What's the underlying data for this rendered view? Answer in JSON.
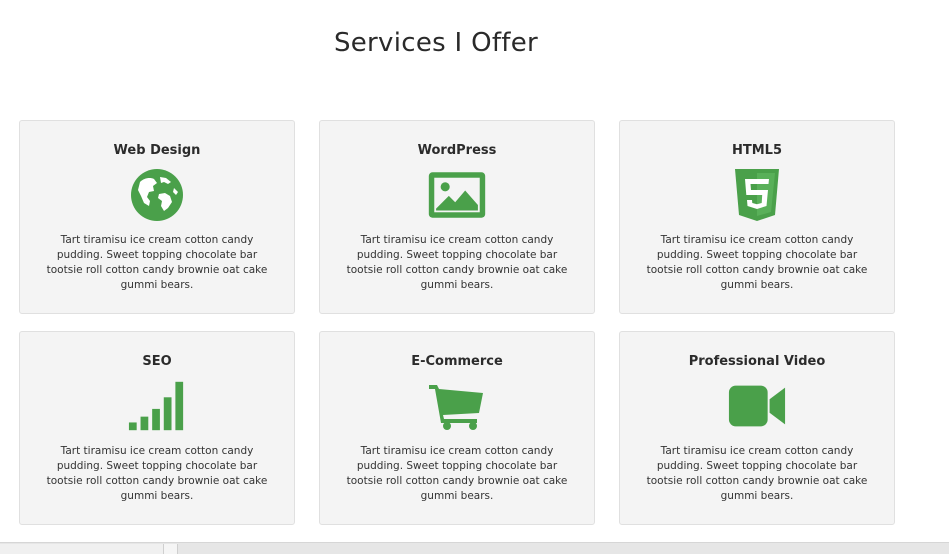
{
  "page": {
    "title": "Services I Offer"
  },
  "theme": {
    "accent": "#4aa04a",
    "card_bg": "#f4f4f4"
  },
  "services": [
    {
      "title": "Web Design",
      "icon": "globe-icon",
      "text": "Tart tiramisu ice cream cotton candy pudding. Sweet topping chocolate bar tootsie roll cotton candy brownie oat cake gummi bears."
    },
    {
      "title": "WordPress",
      "icon": "image-icon",
      "text": "Tart tiramisu ice cream cotton candy pudding. Sweet topping chocolate bar tootsie roll cotton candy brownie oat cake gummi bears."
    },
    {
      "title": "HTML5",
      "icon": "html5-icon",
      "text": "Tart tiramisu ice cream cotton candy pudding. Sweet topping chocolate bar tootsie roll cotton candy brownie oat cake gummi bears."
    },
    {
      "title": "SEO",
      "icon": "signal-bars-icon",
      "text": "Tart tiramisu ice cream cotton candy pudding. Sweet topping chocolate bar tootsie roll cotton candy brownie oat cake gummi bears."
    },
    {
      "title": "E-Commerce",
      "icon": "shopping-cart-icon",
      "text": "Tart tiramisu ice cream cotton candy pudding. Sweet topping chocolate bar tootsie roll cotton candy brownie oat cake gummi bears."
    },
    {
      "title": "Professional Video",
      "icon": "video-camera-icon",
      "text": "Tart tiramisu ice cream cotton candy pudding. Sweet topping chocolate bar tootsie roll cotton candy brownie oat cake gummi bears."
    }
  ]
}
